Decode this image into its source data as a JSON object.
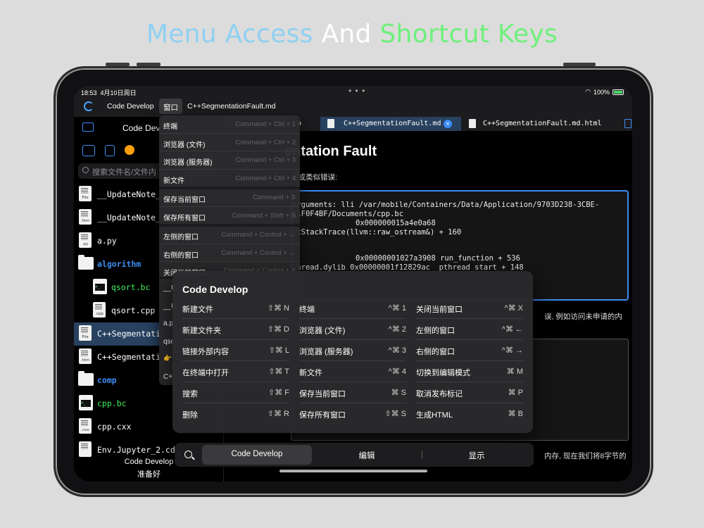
{
  "headline": {
    "part1": "Menu Access",
    "part2": "And",
    "part3": "Shortcut Keys"
  },
  "status": {
    "time": "18:53",
    "date": "4月10日周日",
    "battery": "100%"
  },
  "toolbar": {
    "app": "Code Develop",
    "menu": "窗口",
    "doc": "C++SegmentationFault.md"
  },
  "sidebar": {
    "title": "Code Dev",
    "search_placeholder": "搜索文件名/文件内",
    "files": [
      {
        "name": "__UpdateNote_",
        "ext": "File",
        "kind": "file"
      },
      {
        "name": "__UpdateNote_",
        "ext": ".htm",
        "kind": "file"
      },
      {
        "name": "a.py",
        "ext": ".py",
        "kind": "file"
      },
      {
        "name": "algorithm",
        "ext": "",
        "kind": "folder"
      },
      {
        "name": "qsort.bc",
        "ext": "",
        "kind": "term"
      },
      {
        "name": "qsort.cpp",
        "ext": ".cpp",
        "kind": "file"
      },
      {
        "name": "C++Segmentati",
        "ext": "File",
        "kind": "file"
      },
      {
        "name": "C++Segmentati",
        "ext": ".htm",
        "kind": "file"
      },
      {
        "name": "comp",
        "ext": "",
        "kind": "folder"
      },
      {
        "name": "cpp.bc",
        "ext": "",
        "kind": "term"
      },
      {
        "name": "cpp.cxx",
        "ext": ".cxx",
        "kind": "file"
      },
      {
        "name": "Env.Jupyter_2.cd",
        "ext": "",
        "kind": "file"
      }
    ],
    "footer_app": "Code Develop",
    "footer_status": "准备好"
  },
  "tabs": [
    {
      "label": "o"
    },
    {
      "label": "C++SegmentationFault.md"
    },
    {
      "label": "C++SegmentationFault.md.html"
    }
  ],
  "editor": {
    "title": "entation Fault",
    "line1": "误或类似错误:",
    "code": [
      "arguments: lli /var/mobile/Containers/Data/Application/9703D238-3CBE-",
      "01F0F4BF/Documents/cpp.bc",
      "0x000000015a4e0a68",
      "ntStackTrace(llvm::raw_ostream&) + 160",
      "0x00000001027a3908 run_function + 536",
      "thread.dylib  0x00000001f12829ac _pthread_start + 148"
    ],
    "line2": "误, 例如访问未申请的内",
    "line3": "内存, 现在我们将8字节的"
  },
  "dropdown": {
    "items": [
      {
        "label": "终端",
        "shortcut": "Command + Ctrl + 1"
      },
      {
        "label": "浏览器 (文件)",
        "shortcut": "Command + Ctrl + 2"
      },
      {
        "label": "浏览器 (服务器)",
        "shortcut": "Command + Ctrl + 3"
      },
      {
        "label": "新文件",
        "shortcut": "Command + Ctrl + 4"
      },
      {
        "label": "保存当前窗口",
        "shortcut": "Command + S"
      },
      {
        "label": "保存所有窗口",
        "shortcut": "Command + Shift + S"
      },
      {
        "label": "左侧的窗口",
        "shortcut": "Command + Control + ←"
      },
      {
        "label": "右侧的窗口",
        "shortcut": "Command + Control + →"
      },
      {
        "label": "关闭当前窗口",
        "shortcut": "Command + Control + X"
      }
    ],
    "fragments": [
      "__U",
      "__U",
      "a.p",
      "qso",
      "👉",
      "C+"
    ]
  },
  "overlay": {
    "title": "Code Develop",
    "columns": [
      [
        {
          "label": "新建文件",
          "key": "⇧⌘ N"
        },
        {
          "label": "新建文件夹",
          "key": "⇧⌘ D"
        },
        {
          "label": "链接外部内容",
          "key": "⇧⌘ L"
        },
        {
          "label": "在终端中打开",
          "key": "⇧⌘ T"
        },
        {
          "label": "搜索",
          "key": "⇧⌘ F"
        },
        {
          "label": "删除",
          "key": "⇧⌘ R"
        }
      ],
      [
        {
          "label": "终端",
          "key": "^⌘ 1"
        },
        {
          "label": "浏览器 (文件)",
          "key": "^⌘ 2"
        },
        {
          "label": "浏览器 (服务器)",
          "key": "^⌘ 3"
        },
        {
          "label": "新文件",
          "key": "^⌘ 4"
        },
        {
          "label": "保存当前窗口",
          "key": "⌘ S"
        },
        {
          "label": "保存所有窗口",
          "key": "⇧⌘ S"
        }
      ],
      [
        {
          "label": "关闭当前窗口",
          "key": "^⌘ X"
        },
        {
          "label": "左侧的窗口",
          "key": "^⌘ ←"
        },
        {
          "label": "右侧的窗口",
          "key": "^⌘ →"
        },
        {
          "label": "切换到编辑模式",
          "key": "⌘ M"
        },
        {
          "label": "取消发布标记",
          "key": "⌘ P"
        },
        {
          "label": "生成HTML",
          "key": "⌘ B"
        }
      ]
    ]
  },
  "bottombar": {
    "tabs": [
      "Code Develop",
      "编辑",
      "显示"
    ]
  },
  "colors": {
    "accent": "#3d8df5",
    "selection": "#27415f",
    "headline_blue": "#8fd0f2",
    "headline_green": "#6ff07c"
  }
}
